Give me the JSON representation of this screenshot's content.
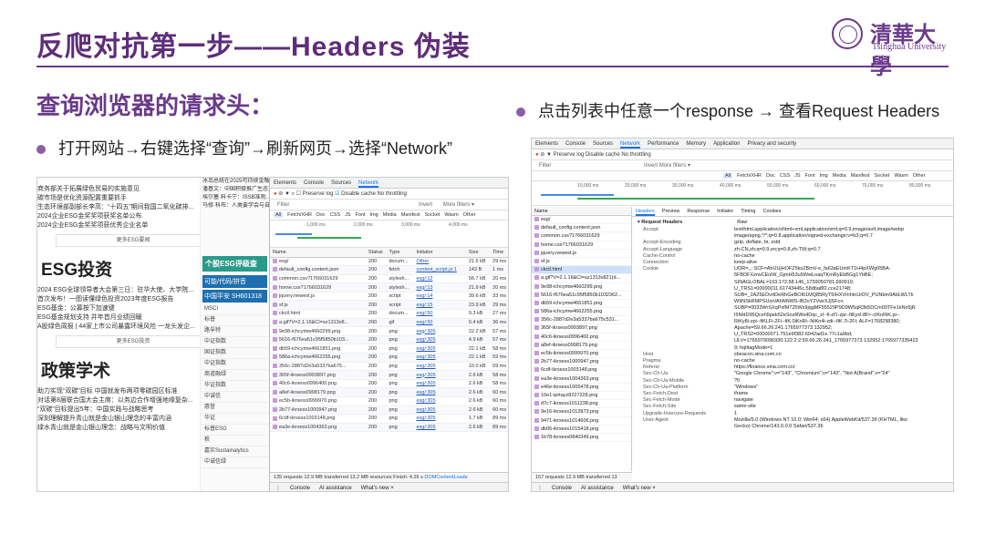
{
  "slide": {
    "title": "反爬对抗第一步——Headers 伪装",
    "subhead": "查询浏览器的请求头：",
    "bullet_left": "打开网站→右键选择“查询”→刷新网页→选择“Network”",
    "bullet_right": "点击列表中任意一个response → 查看Request Headers",
    "logo_cn": "清華大學",
    "logo_en": "Tsinghua University",
    "accent_color": "#6a3a8a"
  },
  "web": {
    "top_lines": [
      "商务部关于拓展绿色贸易的实施意见",
      "碳市场是优化资源配置重要抓手",
      "生态环境部副部长李高：“十四五”期间我国二氧化碳排...",
      "2024企业ESG金奖奖项获奖名单公布",
      "2024企业ESG金奖奖项获优秀企业名单"
    ],
    "more1": "更多ESG要闻",
    "sec1": "ESG投资",
    "sec1_lines": [
      "2024 ESG全球领导者大会第三日：驻华大使、大学院...",
      "首次发布！一图读懂绿色投资2023年度ESG报告",
      "ESG基金：公募按下加速键",
      "ESG基金规划支持 并年首月业绩回暖",
      "A股绿色周报 | 44家上市公司暴露环境风险 一龙头发企..."
    ],
    "more2": "更多ESG投资",
    "sec2": "政策学术",
    "sec2_lines": [
      "助力实现“双碳”目标 中国就发布两项零碳园区标准",
      "对话第8届联合国大会主席：以务边合作增强地缘复杂...",
      "“双碳”目标提出5年：中国实践与战略思考",
      "深刻理解提升青山就是金山银山理念的丰富内涵",
      "绿水青山就是金山银山理念：战略与文明价值"
    ],
    "mid_lines": [
      "冰岛总统在2025可持续金融大会...",
      "潘基文：中国积极推广生态文明...",
      "埃尔塞·科卡宁：ISSB准则...",
      "马修·科布：人类要学会与自然..."
    ],
    "banner": "个股ESG评级查",
    "banner_sub": "可能/代码/拼音",
    "stock": "中国平安 SH601318",
    "side_items": [
      "MSCI",
      "标普",
      "路孚特",
      "中证指数",
      "国证指数",
      "中证指数",
      "商道融绿",
      "华证指数",
      "中诚信",
      "惠誉",
      "华证",
      "标普ESG",
      "秩",
      "嘉实Sustainalytics",
      "中诚信绿"
    ]
  },
  "devtools1": {
    "tabs": [
      "Elements",
      "Console",
      "Sources",
      "Network"
    ],
    "active_tab": "Network",
    "preserve_log": "Preserve log",
    "disable_cache": "Disable cache",
    "throttle": "No throttling",
    "filter": "Filter",
    "invert": "Invert",
    "more_filters": "More filters ▾",
    "types": [
      "All",
      "Fetch/XHR",
      "Doc",
      "CSS",
      "JS",
      "Font",
      "Img",
      "Media",
      "Manifest",
      "Socket",
      "Wasm",
      "Other"
    ],
    "timeline": [
      "1,000 ms",
      "2,000 ms",
      "3,000 ms",
      "4,000 ms"
    ],
    "columns": [
      "Name",
      "Status",
      "Type",
      "Initiator",
      "Size",
      "Time"
    ],
    "rows": [
      [
        "esg/",
        "200",
        "docum...",
        "Other",
        "21.5 kB",
        "29 ms"
      ],
      [
        "default_config.content.json",
        "200",
        "fetch",
        "content_script.js:1",
        "143 B",
        "1 ms"
      ],
      [
        "common.css?1766031629",
        "200",
        "stylesh...",
        "esg/:12",
        "56.7 kB",
        "20 ms"
      ],
      [
        "home.css?1766031629",
        "200",
        "stylesh...",
        "esg/:13",
        "21.9 kB",
        "20 ms"
      ],
      [
        "jquery.newest.js",
        "200",
        "script",
        "esg/:14",
        "39.6 kB",
        "33 ms"
      ],
      [
        "sf.js",
        "200",
        "script",
        "esg/:15",
        "23.9 kB",
        "29 ms"
      ],
      [
        "ckctl.html",
        "200",
        "docum...",
        "esg/:50",
        "0.3 kB",
        "27 ms"
      ],
      [
        "a.gif?V=2.1.16&CI=sz1313x8...",
        "200",
        "gif",
        "esg/:50",
        "0.4 kB",
        "36 ms"
      ],
      [
        "9e98-ichcymw4660299.png",
        "200",
        "png",
        "esg/:305",
        "22.2 kB",
        "57 ms"
      ],
      [
        "5616-f676ea51c95f5850b103...",
        "200",
        "png",
        "esg/:305",
        "4.9 kB",
        "57 ms"
      ],
      [
        "db59-ichcymw4661851.png",
        "200",
        "png",
        "esg/:305",
        "22.1 kB",
        "58 ms"
      ],
      [
        "586a-ichcymw4662255.png",
        "200",
        "png",
        "esg/:305",
        "22.1 kB",
        "59 ms"
      ],
      [
        "356c-2887d2e3a5337ba675...",
        "200",
        "png",
        "esg/:305",
        "10.0 kB",
        "59 ms"
      ],
      [
        "365f-ikrsess0993897.png",
        "200",
        "png",
        "esg/:305",
        "2.6 kB",
        "58 ms"
      ],
      [
        "40c6-ikrsess0996400.png",
        "200",
        "png",
        "esg/:305",
        "2.6 kB",
        "58 ms"
      ],
      [
        "a8ef-ikrsess0998179.png",
        "200",
        "png",
        "esg/:305",
        "2.6 kB",
        "60 ms"
      ],
      [
        "ec5b-ikrsess0999970.png",
        "200",
        "png",
        "esg/:305",
        "2.6 kB",
        "60 ms"
      ],
      [
        "2b77-ikrsess1000947.png",
        "200",
        "png",
        "esg/:305",
        "2.6 kB",
        "60 ms"
      ],
      [
        "6cdf-ikrsess1003148.png",
        "200",
        "png",
        "esg/:305",
        "1.7 kB",
        "89 ms"
      ],
      [
        "ea3e-ikrsess1004363.png",
        "200",
        "png",
        "esg/:305",
        "2.6 kB",
        "89 ms"
      ]
    ],
    "status": "135 requests   12.9 MB transferred   13.2 MB resources   Finish: 4.26 s",
    "status_link": "DOMContentLoade",
    "drawer": [
      "Console",
      "AI assistance",
      "What's new ×"
    ]
  },
  "devtools2": {
    "tabs": [
      "Elements",
      "Console",
      "Sources",
      "Network",
      "Performance",
      "Memory",
      "Application",
      "Privacy and security"
    ],
    "active_tab": "Network",
    "toolbar": "Preserve log   Disable cache   No throttling",
    "filter": "Filter",
    "filter_opts": "Invert   More filters ▾",
    "types": [
      "All",
      "Fetch/XHR",
      "Doc",
      "CSS",
      "JS",
      "Font",
      "Img",
      "Media",
      "Manifest",
      "Socket",
      "Wasm",
      "Other"
    ],
    "timeline": [
      "10,000 ms",
      "20,000 ms",
      "30,000 ms",
      "40,000 ms",
      "50,000 ms",
      "60,000 ms",
      "70,000 ms",
      "80,000 ms"
    ],
    "list_header": "Name",
    "list": [
      "esg/",
      "default_config.content.json",
      "common.css?1766031629",
      "home.css?1766031629",
      "jquery.newest.js",
      "sf.js",
      "ckctl.html",
      "a.gif?V=2.1.16&CI=sz1313x821(d...",
      "9e98-ichcymw4660299.png",
      "5616-f676ea51c95f5850b1032362...",
      "db59-ichcymw4661851.png",
      "586a-ichcymw4662255.png",
      "356c-2887d2e3a5337ba675c531...",
      "365f-ikrsess0993897.png",
      "40c6-ikrsess0996400.png",
      "a8ef-ikrsess0998179.png",
      "ec5b-ikrsess0999970.png",
      "2b77-ikrsess1000947.png",
      "6cdf-ikrsess1003148.png",
      "ea3e-ikrsess1004363.png",
      "e46e-ikrsess1005478.png",
      "10e1-iprtayz8227228.png",
      "d7c7-ikrsess1011238.png",
      "9e16-ikrsess1012873.png",
      "9471-ikrsess1014606.png",
      "db06-ikrsess1015418.png",
      "1b78-ikrsess0840349.png"
    ],
    "detail_tabs": [
      "Headers",
      "Preview",
      "Response",
      "Initiator",
      "Timing",
      "Cookies"
    ],
    "section": "▾ Request Headers",
    "raw": "Raw",
    "headers": [
      [
        "Accept",
        "text/html,application/xhtml+xml,application/xml;q=0.9,image/avif,image/webp"
      ],
      [
        "",
        "image/apng,*/*;q=0.8,application/signed-exchange;v=b3;q=0.7"
      ],
      [
        "Accept-Encoding",
        "gzip, deflate, br, zstd"
      ],
      [
        "Accept-Language",
        "zh-CN,zh;q=0.9,en;q=0.8,zh-TW;q=0.7"
      ],
      [
        "Cache-Control",
        "no-cache"
      ],
      [
        "Connection",
        "keep-alive"
      ],
      [
        "Cookie",
        "UOR=,,; SCF=AhUUjHOFZ5ksZBmV-e_fa63aEUmKT1H4pXWg05BA-"
      ],
      [
        "",
        "5FBDFXzrwCEizW_GjmH53u5WwLoaqTKmRyEbBGg1YbBE;"
      ],
      [
        "",
        "SINAGLOBAL=103.172.58.146_1759050781.690919;"
      ],
      [
        "",
        "U_TRS1=00000011.61743445c.58dba8f2.cce21748;"
      ],
      [
        "",
        "SUB=_2A25EDvrtDeRhGeBOI61MQ85RyT5IHXVmhInUrDV_PUNbm9AbLWLTk"
      ],
      [
        "",
        "W9NSkRMPSUioVAhNNWS-IB2oY2VwrXJjSFcv;"
      ],
      [
        "",
        "SUBP=0033WrSXqPxfM725Ws9jqgMF55529P9D9W5qR3b5DCm00TFe1kNo5jR"
      ],
      [
        "",
        "I5NHD95Qceh5pek52eSozRWs4Dqc_zl--fi-zf1-zpi--fiKyxl-8Fi--clKnRiK.pi--"
      ],
      [
        "",
        "RiKy8i-zpi--fiKLFi-2Fi--fiK.0iKnRi--NiKn4i-zdi--fiK.7i-2Fi; ALF=1768298380;"
      ],
      [
        "",
        "Apache=59.66.26.241.1765977373.132952;"
      ],
      [
        "",
        "U_TRS2=00000071.751e9f382.6942ad1e.77c1a9bd;"
      ],
      [
        "",
        "ULV=1765979096930:122:2:2:59.66.26.241_1765977373.132952:1765977335423"
      ],
      [
        "",
        "9; hqlitagMode=1"
      ],
      [
        "Host",
        "sbeacon.sina.com.cn"
      ],
      [
        "Pragma",
        "no-cache"
      ],
      [
        "Referer",
        "https://finance.sina.com.cn/"
      ],
      [
        "Sec-Ch-Ua",
        "\"Google Chrome\";v=\"143\", \"Chromium\";v=\"143\", \"Not A(Brand\";v=\"24\""
      ],
      [
        "Sec-Ch-Ua-Mobile",
        "?0"
      ],
      [
        "Sec-Ch-Ua-Platform",
        "\"Windows\""
      ],
      [
        "Sec-Fetch-Dest",
        "iframe"
      ],
      [
        "Sec-Fetch-Mode",
        "navigate"
      ],
      [
        "Sec-Fetch-Site",
        "same-site"
      ],
      [
        "Upgrade-Insecure-Requests",
        "1"
      ],
      [
        "User-Agent",
        "Mozilla/5.0 (Windows NT 10.0; Win64; x64) AppleWebKit/537.36 (KHTML, like"
      ],
      [
        "",
        "Gecko) Chrome/143.0.0.0 Safari/537.36"
      ]
    ],
    "status": "157 requests   12.9 MB transferred   13",
    "drawer": [
      "Console",
      "AI assistance",
      "What's new ×"
    ]
  }
}
